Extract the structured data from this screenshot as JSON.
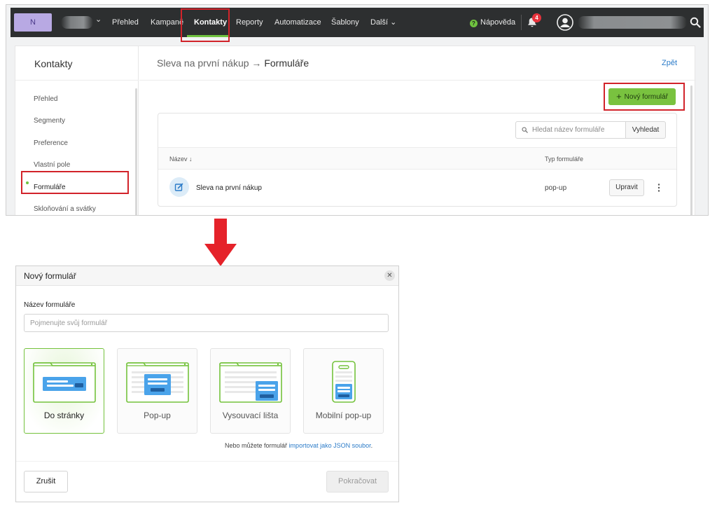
{
  "top_nav": {
    "logo_text": "N",
    "items": [
      "Přehled",
      "Kampaně",
      "Kontakty",
      "Reporty",
      "Automatizace",
      "Šablony",
      "Další"
    ],
    "active": "Kontakty",
    "help_label": "Nápověda",
    "notification_count": "4",
    "accent_color": "#6fc23f"
  },
  "sidebar": {
    "title": "Kontakty",
    "items": [
      "Přehled",
      "Segmenty",
      "Preference",
      "Vlastní pole",
      "Formuláře",
      "Skloňování a svátky"
    ],
    "active": "Formuláře"
  },
  "breadcrumb": {
    "parent": "Sleva na první nákup",
    "separator": "→",
    "current": "Formuláře"
  },
  "back_link": "Zpět",
  "new_form_button": "Nový formulář",
  "search": {
    "placeholder": "Hledat název formuláře",
    "button": "Vyhledat"
  },
  "table": {
    "columns": [
      "Název ↓",
      "Typ formuláře"
    ],
    "rows": [
      {
        "name": "Sleva na první nákup",
        "type": "pop-up",
        "action": "Upravit"
      }
    ]
  },
  "modal": {
    "title": "Nový formulář",
    "field_label": "Název formuláře",
    "field_placeholder": "Pojmenujte svůj formulář",
    "field_value": "",
    "options": [
      "Do stránky",
      "Pop-up",
      "Vysouvací lišta",
      "Mobilní pop-up"
    ],
    "selected_option": "Do stránky",
    "import_text": "Nebo můžete formulář",
    "import_link": "importovat jako JSON soubor",
    "import_suffix": ".",
    "cancel_button": "Zrušit",
    "continue_button": "Pokračovat"
  },
  "highlight_color": "#d2232a"
}
